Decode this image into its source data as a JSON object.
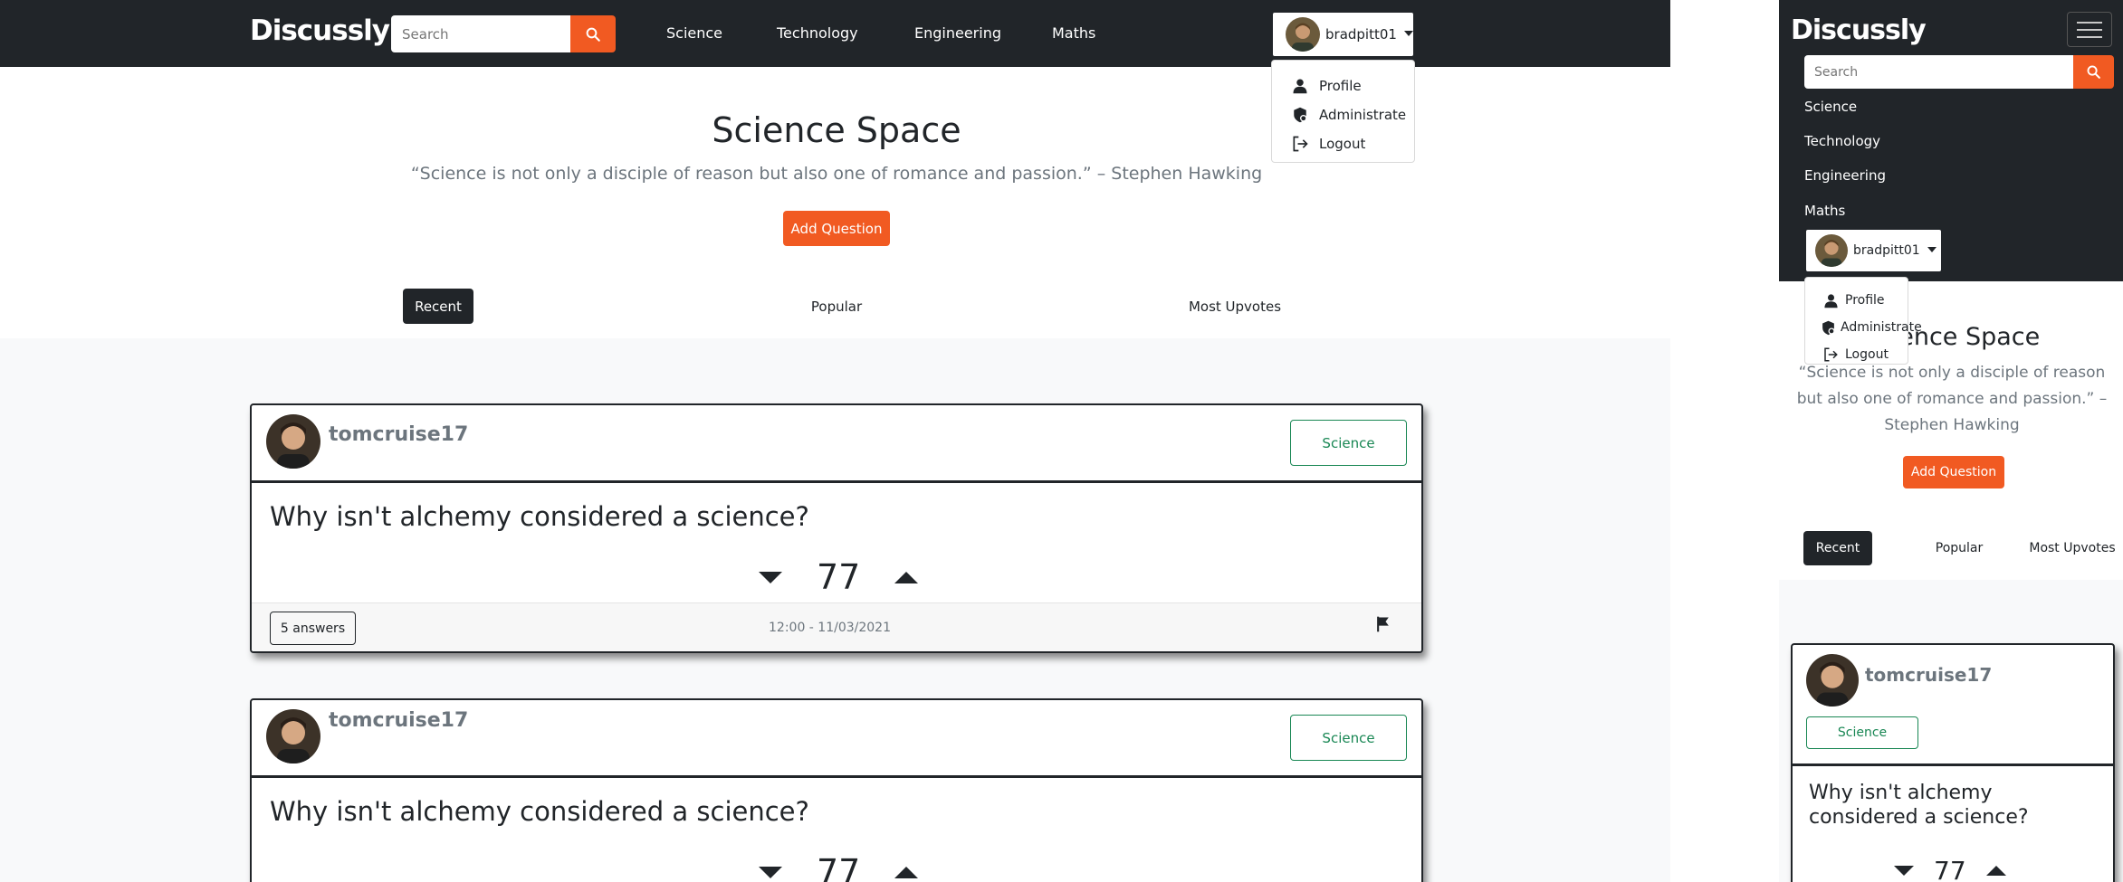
{
  "brand": "Discussly",
  "search": {
    "placeholder": "Search"
  },
  "nav": {
    "science": "Science",
    "technology": "Technology",
    "engineering": "Engineering",
    "maths": "Maths"
  },
  "user": {
    "name": "bradpitt01"
  },
  "user_menu": {
    "profile": "Profile",
    "administrate": "Administrate",
    "logout": "Logout"
  },
  "hero": {
    "title": "Science Space",
    "quote": "“Science is not only a disciple of reason but also one of romance and passion.” – Stephen Hawking",
    "add_question": "Add Question"
  },
  "tabs": {
    "recent": "Recent",
    "popular": "Popular",
    "most_upvotes": "Most Upvotes"
  },
  "questions": [
    {
      "author": "tomcruise17",
      "category": "Science",
      "title": "Why isn't alchemy considered a science?",
      "votes": "77",
      "answers": "5 answers",
      "timestamp": "12:00 - 11/03/2021"
    },
    {
      "author": "tomcruise17",
      "category": "Science",
      "title": "Why isn't alchemy considered a science?",
      "votes": "77"
    }
  ],
  "icons": {
    "search": "search-icon",
    "person": "person-icon",
    "shield": "shield-icon",
    "logout": "logout-icon",
    "flag": "flag-icon",
    "menu": "hamburger-icon"
  },
  "colors": {
    "accent": "#f15a22",
    "dark": "#212529",
    "tag": "#198754",
    "muted": "#6c757d"
  }
}
